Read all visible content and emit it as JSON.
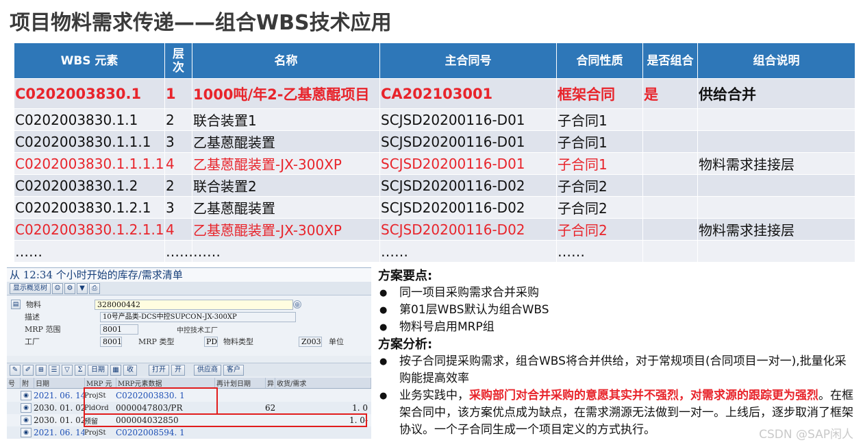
{
  "title": "项目物料需求传递——组合WBS技术应用",
  "table": {
    "headers": [
      "WBS 元素",
      "层\n次",
      "名称",
      "主合同号",
      "合同性质",
      "是否组合",
      "组合说明"
    ],
    "rows": [
      [
        "C0202003830.1",
        "1",
        "1000吨/年2-乙基蒽醌项目",
        "CA202103001",
        "框架合同",
        "是",
        "供给合并"
      ],
      [
        "C0202003830.1.1",
        "2",
        "联合装置1",
        "SCJSD20200116-D01",
        "子合同1",
        "",
        ""
      ],
      [
        "C0202003830.1.1.1",
        "3",
        "乙基蒽醌装置",
        "SCJSD20200116-D01",
        "子合同1",
        "",
        ""
      ],
      [
        "C0202003830.1.1.1.1",
        "4",
        "乙基蒽醌装置-JX-300XP",
        "SCJSD20200116-D01",
        "子合同1",
        "",
        "物料需求挂接层"
      ],
      [
        "C0202003830.1.2",
        "2",
        "联合装置2",
        "SCJSD20200116-D02",
        "子合同2",
        "",
        ""
      ],
      [
        "C0202003830.1.2.1",
        "3",
        "乙基蒽醌装置",
        "SCJSD20200116-D02",
        "子合同2",
        "",
        ""
      ],
      [
        "C0202003830.1.2.1.1",
        "4",
        "乙基蒽醌装置-JX-300XP",
        "SCJSD20200116-D02",
        "子合同2",
        "",
        "物料需求挂接层"
      ],
      [
        "……",
        "……",
        "……",
        "……",
        "……",
        "",
        ""
      ]
    ]
  },
  "sap": {
    "title": "从 12:34 个小时开始的库存/需求清单",
    "show_overview_btn": "显示概览树",
    "material_label": "物料",
    "material_value": "328000442",
    "desc_label": "描述",
    "desc_value": "10号产品类-DCS中控SUPCON-JX-300XP",
    "mrp_area_label": "MRP 范围",
    "mrp_area_value": "8001",
    "mrp_area_desc": "中控技术工厂",
    "plant_label": "工厂",
    "plant_value": "8001",
    "mrp_type_label": "MRP 类型",
    "mrp_type_value": "PD",
    "mat_type_label": "物料类型",
    "mat_type_value": "Z003",
    "unit_label": "单位",
    "tb_date": "日期",
    "tb_receive": "收",
    "tb_open": "打开",
    "tb_open2": "开",
    "tb_vendor": "供应商",
    "tb_customer": "客户",
    "col_headers": [
      "号",
      "附",
      "日期",
      "MRP 元",
      "MRP元素数据",
      "再计划日期",
      "异",
      "收货/需求"
    ],
    "rows": [
      {
        "date": "2021. 06. 14",
        "elem": "ProjSt",
        "data": "C0202003830. 1",
        "exc": "",
        "qty": "",
        "blue": true
      },
      {
        "date": "2030. 01. 02",
        "elem": "PldOrd",
        "data": "0000047803/PR",
        "exc": "62",
        "qty": "1. 0",
        "blue": false
      },
      {
        "date": "2030. 01. 02",
        "elem": "预留",
        "data": "000004032850",
        "exc": "",
        "qty": "1. 0-",
        "blue": false
      },
      {
        "date": "2021. 06. 14",
        "elem": "ProjSt",
        "data": "C0202008594. 1",
        "exc": "",
        "qty": "",
        "blue": true
      }
    ]
  },
  "notes": {
    "h1": "方案要点:",
    "points": [
      "同一项目采购需求合并采购",
      "第01层WBS默认为组合WBS",
      "物料号启用MRP组"
    ],
    "h2": "方案分析:",
    "analysis1": "按子合同提采购需求，组合WBS将合并供给，对于常规项目(合同项目一对一),批量化采购能提高效率",
    "analysis2_a": "业务实践中，",
    "analysis2_em": "采购部门对合并采购的意愿其实并不强烈，对需求源的跟踪更为强烈",
    "analysis2_b": "。在框架合同中，该方案优点成为缺点，在需求溯源无法做到一对一。上线后，逐步取消了框架协议。一个子合同生成一个项目定义的方式执行。",
    "watermark": "CSDN @SAP闲人"
  },
  "colors": {
    "header_blue": "#2e77b8",
    "red": "#e8242b",
    "sap_blue": "#173f7a"
  }
}
